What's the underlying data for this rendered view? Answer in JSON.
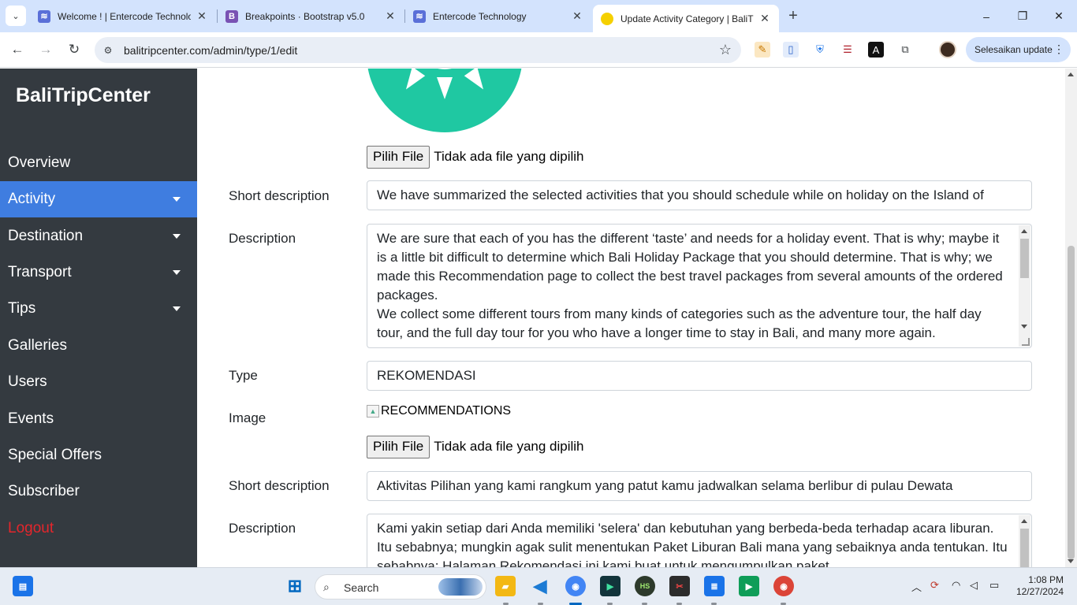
{
  "browser": {
    "tabs": [
      {
        "title": "Welcome ! | Entercode Technolo",
        "favicon_color": "#5a6fd8",
        "favicon_text": "",
        "active": false
      },
      {
        "title": "Breakpoints · Bootstrap v5.0",
        "favicon_color": "#7952b3",
        "favicon_text": "B",
        "active": false
      },
      {
        "title": "Entercode Technology",
        "favicon_color": "#5a6fd8",
        "favicon_text": "",
        "active": false
      },
      {
        "title": "Update Activity Category | BaliT",
        "favicon_color": "#f5d000",
        "favicon_text": "",
        "active": true
      }
    ],
    "close_glyph": "✕",
    "new_tab_glyph": "+",
    "url": "balitripcenter.com/admin/type/1/edit",
    "update_button": "Selesaikan update",
    "window": {
      "minimize": "–",
      "maximize": "❐",
      "close": "✕"
    }
  },
  "sidebar": {
    "brand": "BaliTripCenter",
    "items": [
      {
        "label": "Overview",
        "dropdown": false,
        "active": false
      },
      {
        "label": "Activity",
        "dropdown": true,
        "active": true
      },
      {
        "label": "Destination",
        "dropdown": true,
        "active": false
      },
      {
        "label": "Transport",
        "dropdown": true,
        "active": false
      },
      {
        "label": "Tips",
        "dropdown": true,
        "active": false
      },
      {
        "label": "Galleries",
        "dropdown": false,
        "active": false
      },
      {
        "label": "Users",
        "dropdown": false,
        "active": false
      },
      {
        "label": "Events",
        "dropdown": false,
        "active": false
      },
      {
        "label": "Special Offers",
        "dropdown": false,
        "active": false
      },
      {
        "label": "Subscriber",
        "dropdown": false,
        "active": false
      }
    ],
    "logout": "Logout"
  },
  "form": {
    "file_button": "Pilih File",
    "file_none": "Tidak ada file yang dipilih",
    "section_en": {
      "short_description_label": "Short description",
      "short_description_value": "We have summarized the selected activities that you should schedule while on holiday on the Island of",
      "description_label": "Description",
      "description_lines": [
        "We are sure that each of you has the different ‘taste’ and needs for a holiday event. That is why; maybe it is a little bit difficult to determine which Bali Holiday Package that you should determine. That is why; we made this Recommendation page to collect the best travel packages from several amounts of the ordered packages.",
        "We collect some different tours from many kinds of categories such as the adventure tour, the half day tour, and the full day tour for you who have a longer time to stay in Bali, and many more again."
      ]
    },
    "type_label": "Type",
    "type_value": "REKOMENDASI",
    "section_id": {
      "image_label": "Image",
      "image_alt": "RECOMMENDATIONS",
      "short_description_label": "Short description",
      "short_description_value": "Aktivitas Pilihan yang kami rangkum yang patut kamu jadwalkan selama berlibur di pulau Dewata",
      "description_label": "Description",
      "description_lines": [
        "Kami yakin setiap dari Anda memiliki 'selera' dan kebutuhan yang berbeda-beda terhadap acara liburan. Itu sebabnya; mungkin agak sulit menentukan Paket Liburan Bali mana yang sebaiknya anda tentukan. Itu sebabnya; Halaman Rekomendasi ini kami buat untuk mengumpulkan paket"
      ]
    }
  },
  "taskbar": {
    "search": "Search",
    "time": "1:08 PM",
    "date": "12/27/2024"
  },
  "colors": {
    "sidebar_bg": "#343a40",
    "active_item": "#3f7de0",
    "logout": "#e4262c",
    "logo_teal": "#1fc8a2"
  }
}
